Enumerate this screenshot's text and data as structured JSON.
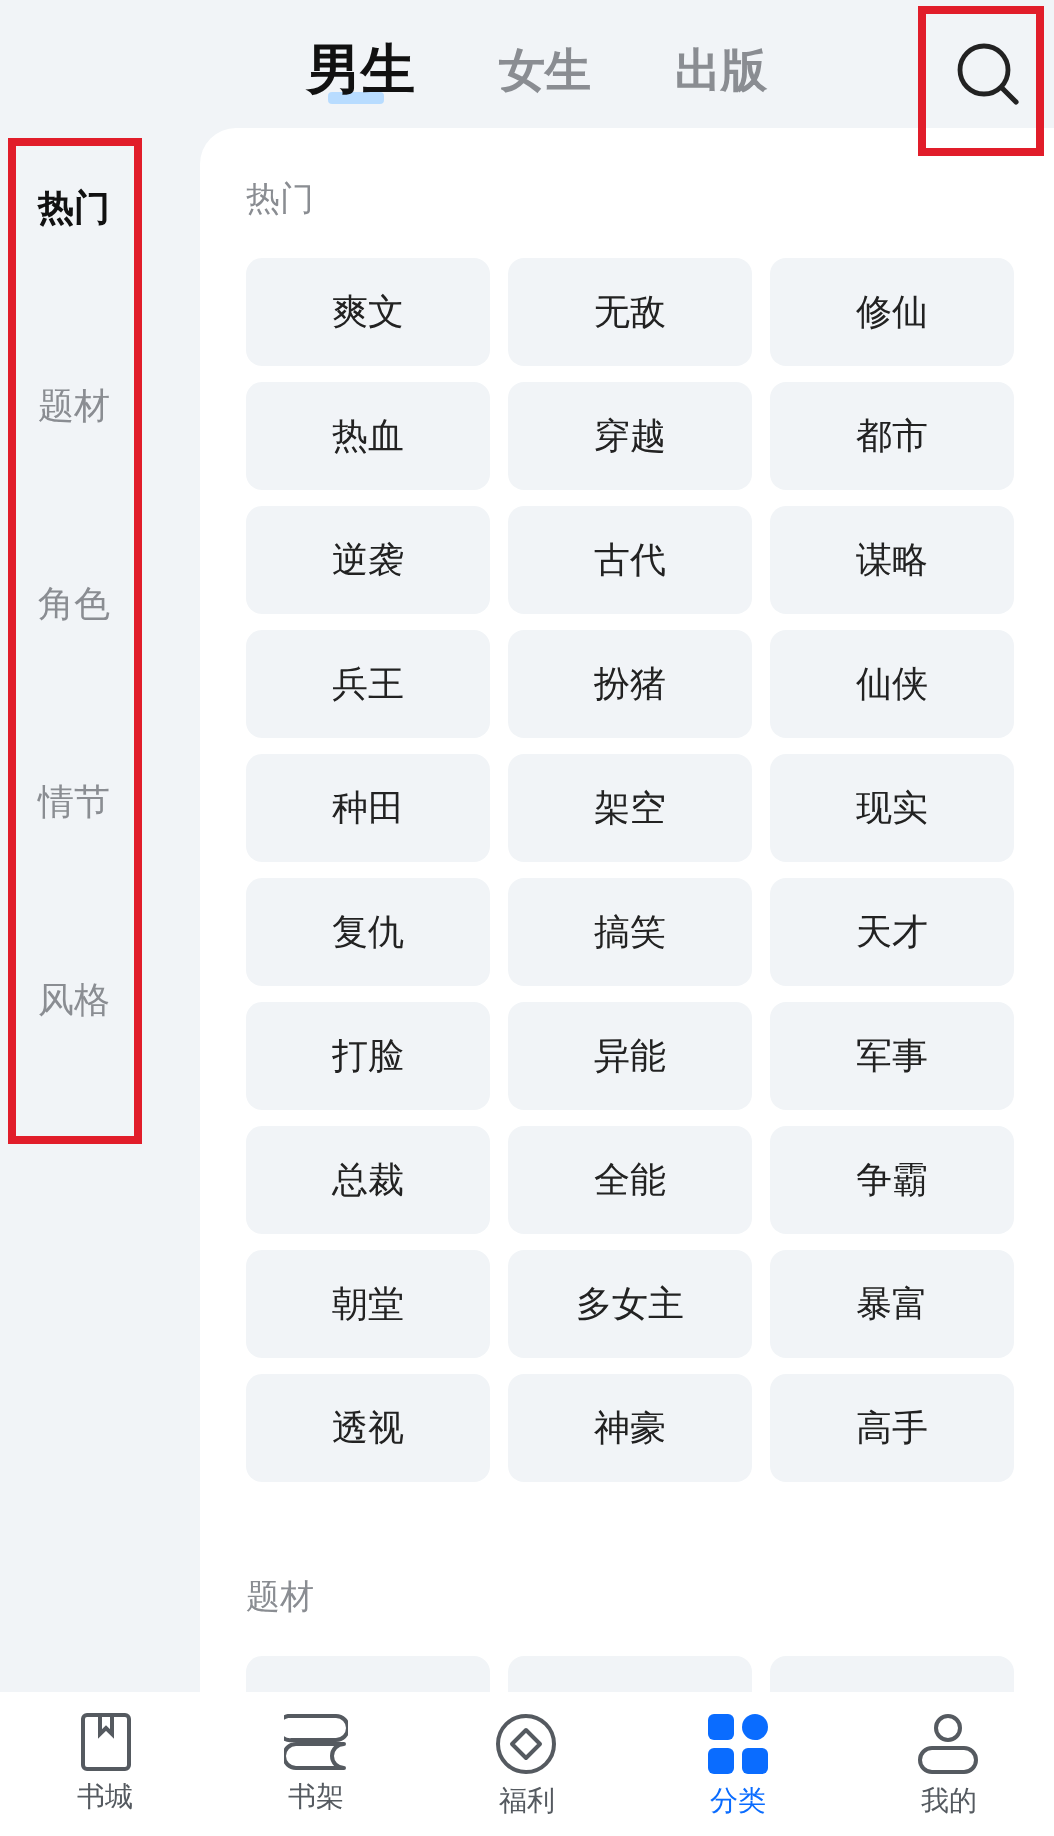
{
  "tabs": [
    {
      "label": "男生",
      "selected": true
    },
    {
      "label": "女生",
      "selected": false
    },
    {
      "label": "出版",
      "selected": false
    }
  ],
  "search": {
    "highlighted": true
  },
  "sidebar": {
    "highlighted": true,
    "items": [
      {
        "label": "热门",
        "selected": true
      },
      {
        "label": "题材",
        "selected": false
      },
      {
        "label": "角色",
        "selected": false
      },
      {
        "label": "情节",
        "selected": false
      },
      {
        "label": "风格",
        "selected": false
      }
    ]
  },
  "sections": [
    {
      "title": "热门",
      "tags": [
        "爽文",
        "无敌",
        "修仙",
        "热血",
        "穿越",
        "都市",
        "逆袭",
        "古代",
        "谋略",
        "兵王",
        "扮猪",
        "仙侠",
        "种田",
        "架空",
        "现实",
        "复仇",
        "搞笑",
        "天才",
        "打脸",
        "异能",
        "军事",
        "总裁",
        "全能",
        "争霸",
        "朝堂",
        "多女主",
        "暴富",
        "透视",
        "神豪",
        "高手"
      ]
    },
    {
      "title": "题材",
      "more_below": true
    }
  ],
  "bottom_nav": [
    {
      "label": "书城",
      "kind": "book",
      "selected": false
    },
    {
      "label": "书架",
      "kind": "shelf",
      "selected": false
    },
    {
      "label": "福利",
      "kind": "coin",
      "selected": false
    },
    {
      "label": "分类",
      "kind": "grid",
      "selected": true
    },
    {
      "label": "我的",
      "kind": "person",
      "selected": false
    }
  ]
}
